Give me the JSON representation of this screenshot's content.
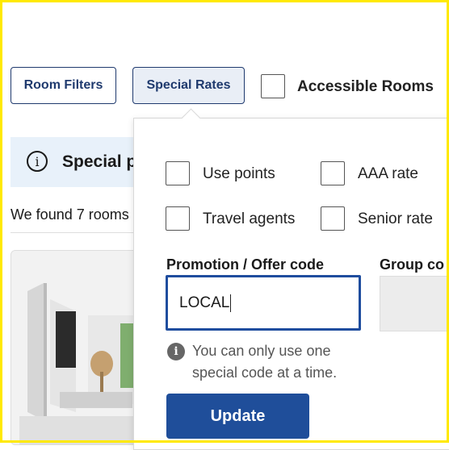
{
  "toolbar": {
    "room_filters_label": "Room Filters",
    "special_rates_label": "Special Rates",
    "accessible_rooms_label": "Accessible Rooms"
  },
  "notice": {
    "text": "Special p"
  },
  "results": {
    "found_text": "We found 7 rooms"
  },
  "special_rates_panel": {
    "options": [
      {
        "label": "Use points",
        "checked": false
      },
      {
        "label": "AAA rate",
        "checked": false
      },
      {
        "label": "Travel agents",
        "checked": false
      },
      {
        "label": "Senior rate",
        "checked": false
      }
    ],
    "promo_label": "Promotion / Offer code",
    "promo_value": "LOCAL",
    "group_label": "Group co",
    "help_text": "You can only use one special code at a time.",
    "update_label": "Update"
  },
  "colors": {
    "accent": "#1f4e9a",
    "outline": "#1f3a6e",
    "notice_bg": "#e8f1fa"
  }
}
